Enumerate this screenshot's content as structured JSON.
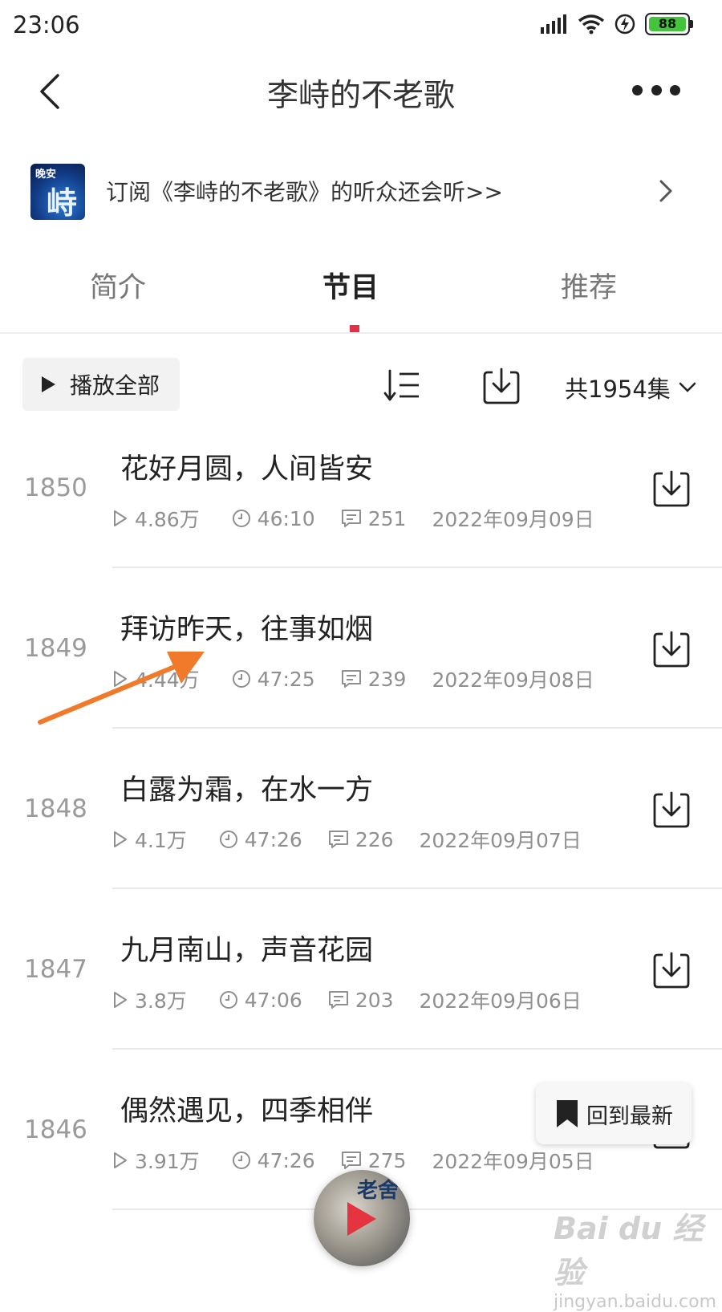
{
  "status_bar": {
    "time": "23:06",
    "battery": "88"
  },
  "header": {
    "title": "李峙的不老歌"
  },
  "recommend_banner": {
    "cover_text": "晚安",
    "cover_big": "峙",
    "text": "订阅《李峙的不老歌》的听众还会听>>"
  },
  "tabs": [
    {
      "label": "简介",
      "active": false
    },
    {
      "label": "节目",
      "active": true
    },
    {
      "label": "推荐",
      "active": false
    }
  ],
  "toolbar": {
    "play_all_label": "播放全部",
    "episode_count": "共1954集"
  },
  "episodes": [
    {
      "number": "1850",
      "title": "花好月圆，人间皆安",
      "plays": "4.86万",
      "duration": "46:10",
      "comments": "251",
      "date": "2022年09月09日"
    },
    {
      "number": "1849",
      "title": "拜访昨天，往事如烟",
      "plays": "4.44万",
      "duration": "47:25",
      "comments": "239",
      "date": "2022年09月08日"
    },
    {
      "number": "1848",
      "title": "白露为霜，在水一方",
      "plays": "4.1万",
      "duration": "47:26",
      "comments": "226",
      "date": "2022年09月07日"
    },
    {
      "number": "1847",
      "title": "九月南山，声音花园",
      "plays": "3.8万",
      "duration": "47:06",
      "comments": "203",
      "date": "2022年09月06日"
    },
    {
      "number": "1846",
      "title": "偶然遇见，四季相伴",
      "plays": "3.91万",
      "duration": "47:26",
      "comments": "275",
      "date": "2022年09月05日"
    }
  ],
  "floating": {
    "back_to_latest_label": "回到最新",
    "mini_player_cover_text": "老舍"
  },
  "watermark": {
    "logo": "Bai du 经验",
    "url": "jingyan.baidu.com"
  },
  "colors": {
    "accent": "#e0334a",
    "annotation_arrow": "#f07a2a",
    "battery": "#43c43c"
  }
}
